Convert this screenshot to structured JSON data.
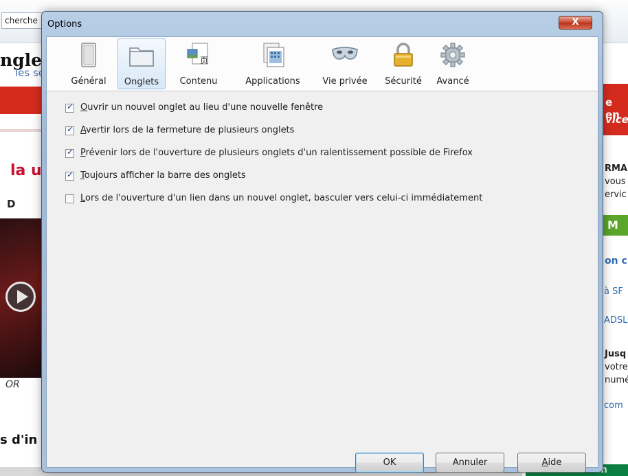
{
  "background_page": {
    "search_text": "cherche",
    "heading_partial": "nglets",
    "link_partial": "les se",
    "red_heading_partial": "la u",
    "subheading_partial": "D",
    "video_caption_partial": "OR",
    "bottom_heading_partial": "s d'in",
    "right_red_line1": "e en",
    "right_red_line2": "vices",
    "right_block_lines": [
      "RMA",
      "vous",
      "ervic"
    ],
    "right_green_text": "M",
    "right_bold_link": "on c",
    "right_links": [
      "à SF",
      "ADSL"
    ],
    "right_text_lines": [
      "Jusq",
      "votre",
      "numé"
    ],
    "right_link_com": "com",
    "footer_brand": "Cetelem"
  },
  "dialog": {
    "title": "Options",
    "close_label": "X",
    "panes": [
      {
        "id": "general",
        "label": "Général",
        "icon": "general-switch-icon",
        "selected": false
      },
      {
        "id": "tabs",
        "label": "Onglets",
        "icon": "tabs-folder-icon",
        "selected": true
      },
      {
        "id": "content",
        "label": "Contenu",
        "icon": "content-page-icon",
        "selected": false
      },
      {
        "id": "applications",
        "label": "Applications",
        "icon": "applications-icon",
        "selected": false
      },
      {
        "id": "privacy",
        "label": "Vie privée",
        "icon": "privacy-mask-icon",
        "selected": false
      },
      {
        "id": "security",
        "label": "Sécurité",
        "icon": "security-padlock-icon",
        "selected": false
      },
      {
        "id": "advanced",
        "label": "Avancé",
        "icon": "advanced-gear-icon",
        "selected": false
      }
    ],
    "options": [
      {
        "accel": "O",
        "rest": "uvrir un nouvel onglet au lieu d'une nouvelle fenêtre",
        "checked": true
      },
      {
        "accel": "A",
        "rest": "vertir lors de la fermeture de plusieurs onglets",
        "checked": true
      },
      {
        "accel": "P",
        "rest": "révenir lors de l'ouverture de plusieurs onglets d'un ralentissement possible de Firefox",
        "checked": true
      },
      {
        "accel": "T",
        "rest": "oujours afficher la barre des onglets",
        "checked": true
      },
      {
        "accel": "L",
        "rest": "ors de l'ouverture d'un lien dans un nouvel onglet, basculer vers celui-ci immédiatement",
        "checked": false
      }
    ],
    "buttons": {
      "ok": "OK",
      "cancel": "Annuler",
      "help_accel": "A",
      "help_rest": "ide"
    },
    "colors": {
      "frame": "#a9c3de",
      "close_button": "#c9442e",
      "selected_pane": "#d8e8f7",
      "checkmark": "#23468c"
    }
  }
}
